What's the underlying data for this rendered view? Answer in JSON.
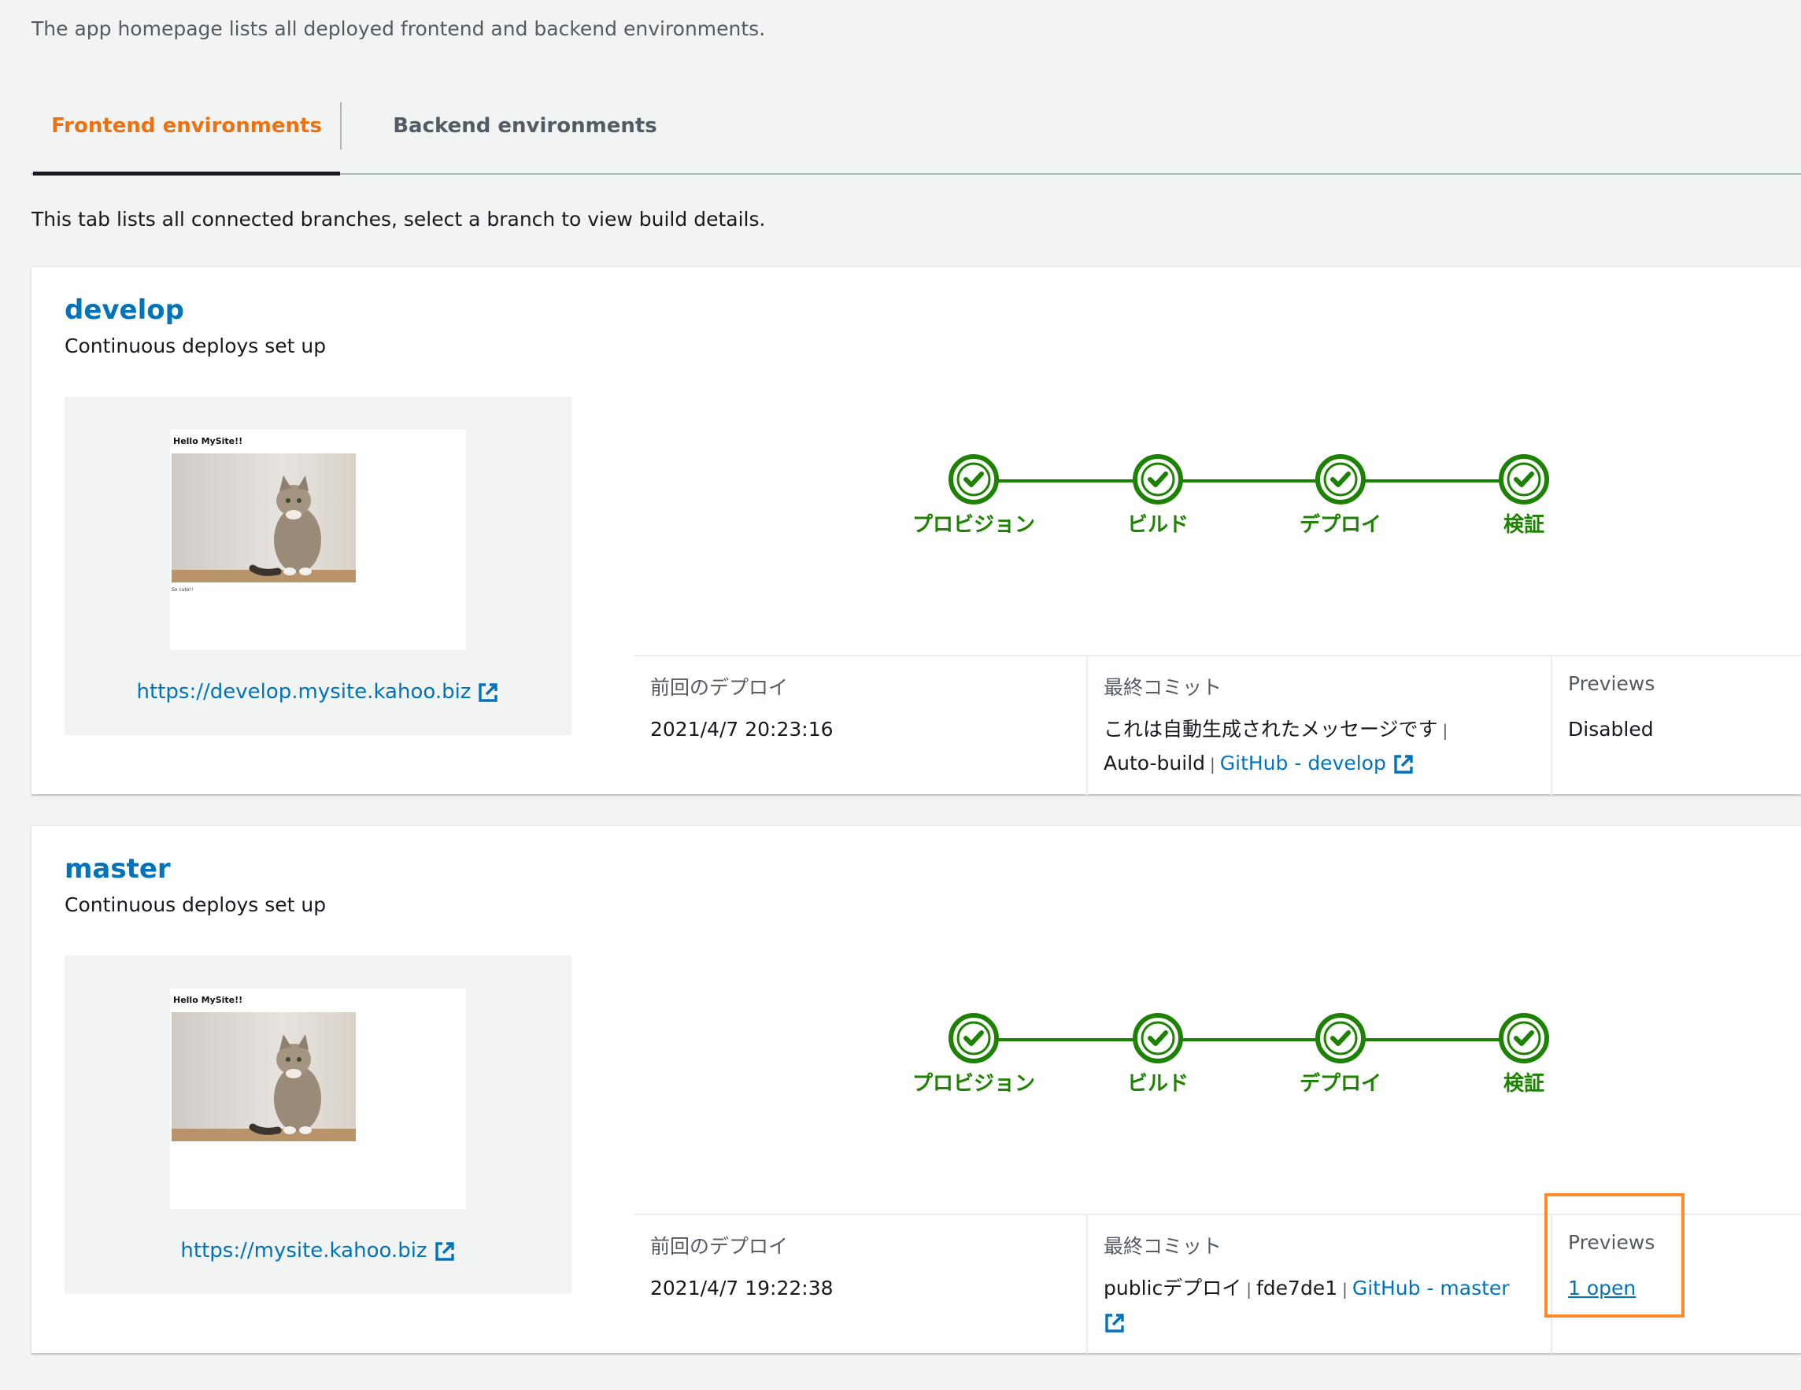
{
  "intro": "The app homepage lists all deployed frontend and backend environments.",
  "tabs": [
    {
      "label": "Frontend environments",
      "active": true
    },
    {
      "label": "Backend environments",
      "active": false
    }
  ],
  "tab_description": "This tab lists all connected branches, select a branch to view build details.",
  "colors": {
    "accent": "#ec7211",
    "link": "#0073bb",
    "success": "#1d8102",
    "highlight": "#ff8a2a"
  },
  "stages": [
    "プロビジョン",
    "ビルド",
    "デプロイ",
    "検証"
  ],
  "branches": [
    {
      "name": "develop",
      "status": "Continuous deploys set up",
      "thumbnail_title": "Hello MySite!!",
      "thumbnail_caption": "So cute!!",
      "url": "https://develop.mysite.kahoo.biz",
      "last_deploy_label": "前回のデプロイ",
      "last_deploy_value": "2021/4/7 20:23:16",
      "last_commit_label": "最終コミット",
      "commit_message": "これは自動生成されたメッセージです",
      "commit_id": "Auto-build",
      "repo_link": "GitHub - develop",
      "previews_label": "Previews",
      "previews_value": "Disabled"
    },
    {
      "name": "master",
      "status": "Continuous deploys set up",
      "thumbnail_title": "Hello MySite!!",
      "thumbnail_caption": "",
      "url": "https://mysite.kahoo.biz",
      "last_deploy_label": "前回のデプロイ",
      "last_deploy_value": "2021/4/7 19:22:38",
      "last_commit_label": "最終コミット",
      "commit_message": "publicデプロイ",
      "commit_id": "fde7de1",
      "repo_link": "GitHub - master",
      "previews_label": "Previews",
      "previews_value": "1 open"
    }
  ]
}
